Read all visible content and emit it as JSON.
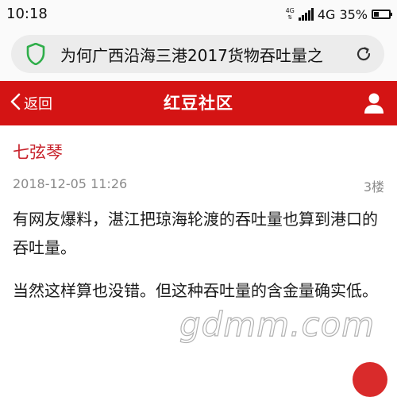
{
  "status_bar": {
    "time": "10:18",
    "network_small": "4G",
    "network": "4G",
    "battery": "35%",
    "battery_level": 0.35
  },
  "address_bar": {
    "title": "为何广西沿海三港2017货物吞吐量之"
  },
  "header": {
    "back_label": "返回",
    "title": "红豆社区"
  },
  "post": {
    "author": "七弦琴",
    "date": "2018-12-05 11:26",
    "floor": "3楼",
    "paragraphs": [
      "有网友爆料，湛江把琼海轮渡的吞吐量也算到港口的吞吐量。",
      "当然这样算也没错。但这种吞吐量的含金量确实低。"
    ]
  },
  "watermark": "gdmm.com",
  "colors": {
    "header_red": "#d41414",
    "author_red": "#c8232c",
    "shield_green": "#2fae4a"
  },
  "icons": {
    "shield": "shield-icon",
    "refresh": "refresh-icon",
    "back": "chevron-left-icon",
    "user": "user-icon"
  }
}
